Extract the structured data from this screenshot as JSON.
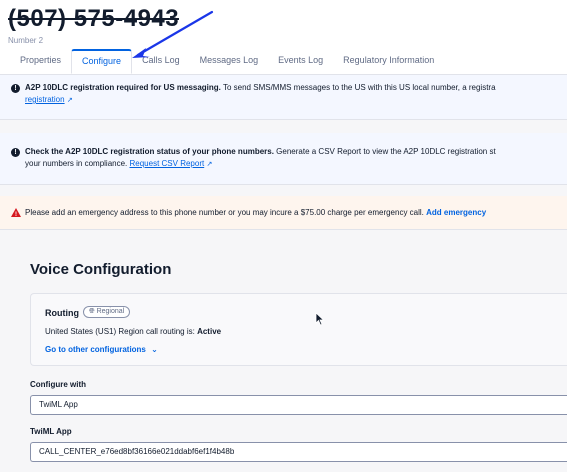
{
  "header": {
    "phone_number": "(507) 575-4943",
    "number_label": "Number 2"
  },
  "tabs": [
    {
      "label": "Properties",
      "active": false
    },
    {
      "label": "Configure",
      "active": true
    },
    {
      "label": "Calls Log",
      "active": false
    },
    {
      "label": "Messages Log",
      "active": false
    },
    {
      "label": "Events Log",
      "active": false
    },
    {
      "label": "Regulatory Information",
      "active": false
    }
  ],
  "banners": {
    "a2p_required": {
      "bold": "A2P 10DLC registration required for US messaging.",
      "text": " To send SMS/MMS messages to the US with this US local number, a registra",
      "link": "registration"
    },
    "a2p_status": {
      "bold": "Check the A2P 10DLC registration status of your phone numbers.",
      "text": " Generate a CSV Report to view the A2P 10DLC registration st",
      "line2": "your numbers in compliance. ",
      "link": "Request CSV Report"
    },
    "emergency": {
      "text": "Please add an emergency address to this phone number or you may incure a $75.00 charge per emergency call. ",
      "link": "Add emergency"
    }
  },
  "voice": {
    "title": "Voice Configuration",
    "routing_label": "Routing",
    "routing_badge": "Regional",
    "routing_status_prefix": "United States (US1) Region call routing is: ",
    "routing_status_value": "Active",
    "goto_link": "Go to other configurations"
  },
  "fields": {
    "configure_with_label": "Configure with",
    "configure_with_value": "TwiML App",
    "twiml_app_label": "TwiML App",
    "twiml_app_value": "CALL_CENTER_e76ed8bf36166e021ddabf6ef1f4b48b"
  },
  "colors": {
    "accent": "#0263e0",
    "annotation": "#1a36e8",
    "warning": "#d6181f"
  }
}
